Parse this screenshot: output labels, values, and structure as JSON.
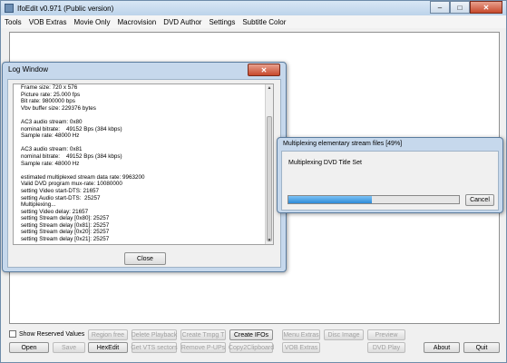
{
  "window": {
    "title": "IfoEdit v0.971 (Public version)",
    "minimize": "–",
    "maximize": "□",
    "close": "✕"
  },
  "menu": [
    "Tools",
    "VOB Extras",
    "Movie Only",
    "Macrovision",
    "DVD Author",
    "Settings",
    "Subtitle Color"
  ],
  "log_window": {
    "title": "Log Window",
    "close_glyph": "✕",
    "lines": [
      "Frame size: 720 x 576",
      "Picture rate: 25.000 fps",
      "Bit rate: 9800000 bps",
      "Vbv buffer size: 229376 bytes",
      "",
      "AC3 audio stream: 0x80",
      "nominal bitrate:    49152 Bps (384 kbps)",
      "Sample rate: 48000 Hz",
      "",
      "AC3 audio stream: 0x81",
      "nominal bitrate:    49152 Bps (384 kbps)",
      "Sample rate: 48000 Hz",
      "",
      "estimated multiplexed stream data rate: 9963200",
      "Valid DVD program mux-rate: 10080000",
      "setting Video start-DTS: 21657",
      "setting Audio start-DTS:  25257",
      "Multiplexing...",
      "setting Video delay: 21657",
      "setting Stream delay [0x80]: 25257",
      "setting Stream delay [0x81]: 25257",
      "setting Stream delay [0x20]: 25257",
      "setting Stream delay [0x21]: 25257"
    ],
    "close_button": "Close"
  },
  "progress_dialog": {
    "title": "Multiplexing elementary stream files [49%]",
    "label": "Multiplexing DVD Title Set",
    "progress": 0.49,
    "cancel": "Cancel"
  },
  "controls": {
    "show_reserved": "Show Reserved Values",
    "region_free": "Region free",
    "delete_playback": "Delete Playback",
    "create_tmpg": "Create Tmpg T",
    "create_ifos": "Create IFOs",
    "menu_extras": "Menu Extras",
    "disc_image": "Disc Image",
    "preview": "Preview",
    "open": "Open",
    "save": "Save",
    "hexedit": "HexEdit",
    "get_vts_sectors": "Get VTS sectors",
    "remove_pups": "Remove P-UPs",
    "copy2clipboard": "Copy2Clipboard",
    "vob_extras": "VOB Extras",
    "dvd_play": "DVD Play",
    "about": "About",
    "quit": "Quit"
  }
}
